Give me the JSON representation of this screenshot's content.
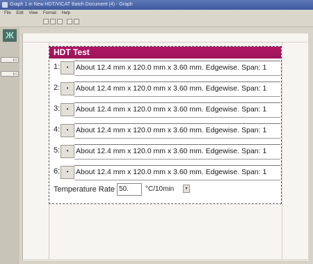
{
  "window": {
    "title": "Graph 1 in New HDT/VICAT Batch Document (4) - Graph"
  },
  "menu": {
    "items": [
      "File",
      "Edit",
      "View",
      "Format",
      "Help"
    ]
  },
  "panel": {
    "title": "HDT Test",
    "rows": [
      {
        "num": "1:",
        "button": "•",
        "text": "About 12.4 mm x 120.0 mm x 3.60 mm. Edgewise. Span: 1"
      },
      {
        "num": "2:",
        "button": "•",
        "text": "About 12.4 mm x 120.0 mm x 3.60 mm. Edgewise. Span: 1"
      },
      {
        "num": "3:",
        "button": "•",
        "text": "About 12.4 mm x 120.0 mm x 3.60 mm. Edgewise. Span: 1"
      },
      {
        "num": "4:",
        "button": "•",
        "text": "About 12.4 mm x 120.0 mm x 3.60 mm. Edgewise. Span: 1"
      },
      {
        "num": "5:",
        "button": "•",
        "text": "About 12.4 mm x 120.0 mm x 3.60 mm. Edgewise. Span: 1"
      },
      {
        "num": "6:",
        "button": "•",
        "text": "About 12.4 mm x 120.0 mm x 3.60 mm. Edgewise. Span: 1"
      }
    ],
    "temperature": {
      "label": "Temperature Rate",
      "value": "50.",
      "unit": "°C/10min",
      "dropdown_glyph": "▾"
    }
  },
  "colors": {
    "header_accent": "#b01865",
    "title_bar": "#4a67a8"
  }
}
